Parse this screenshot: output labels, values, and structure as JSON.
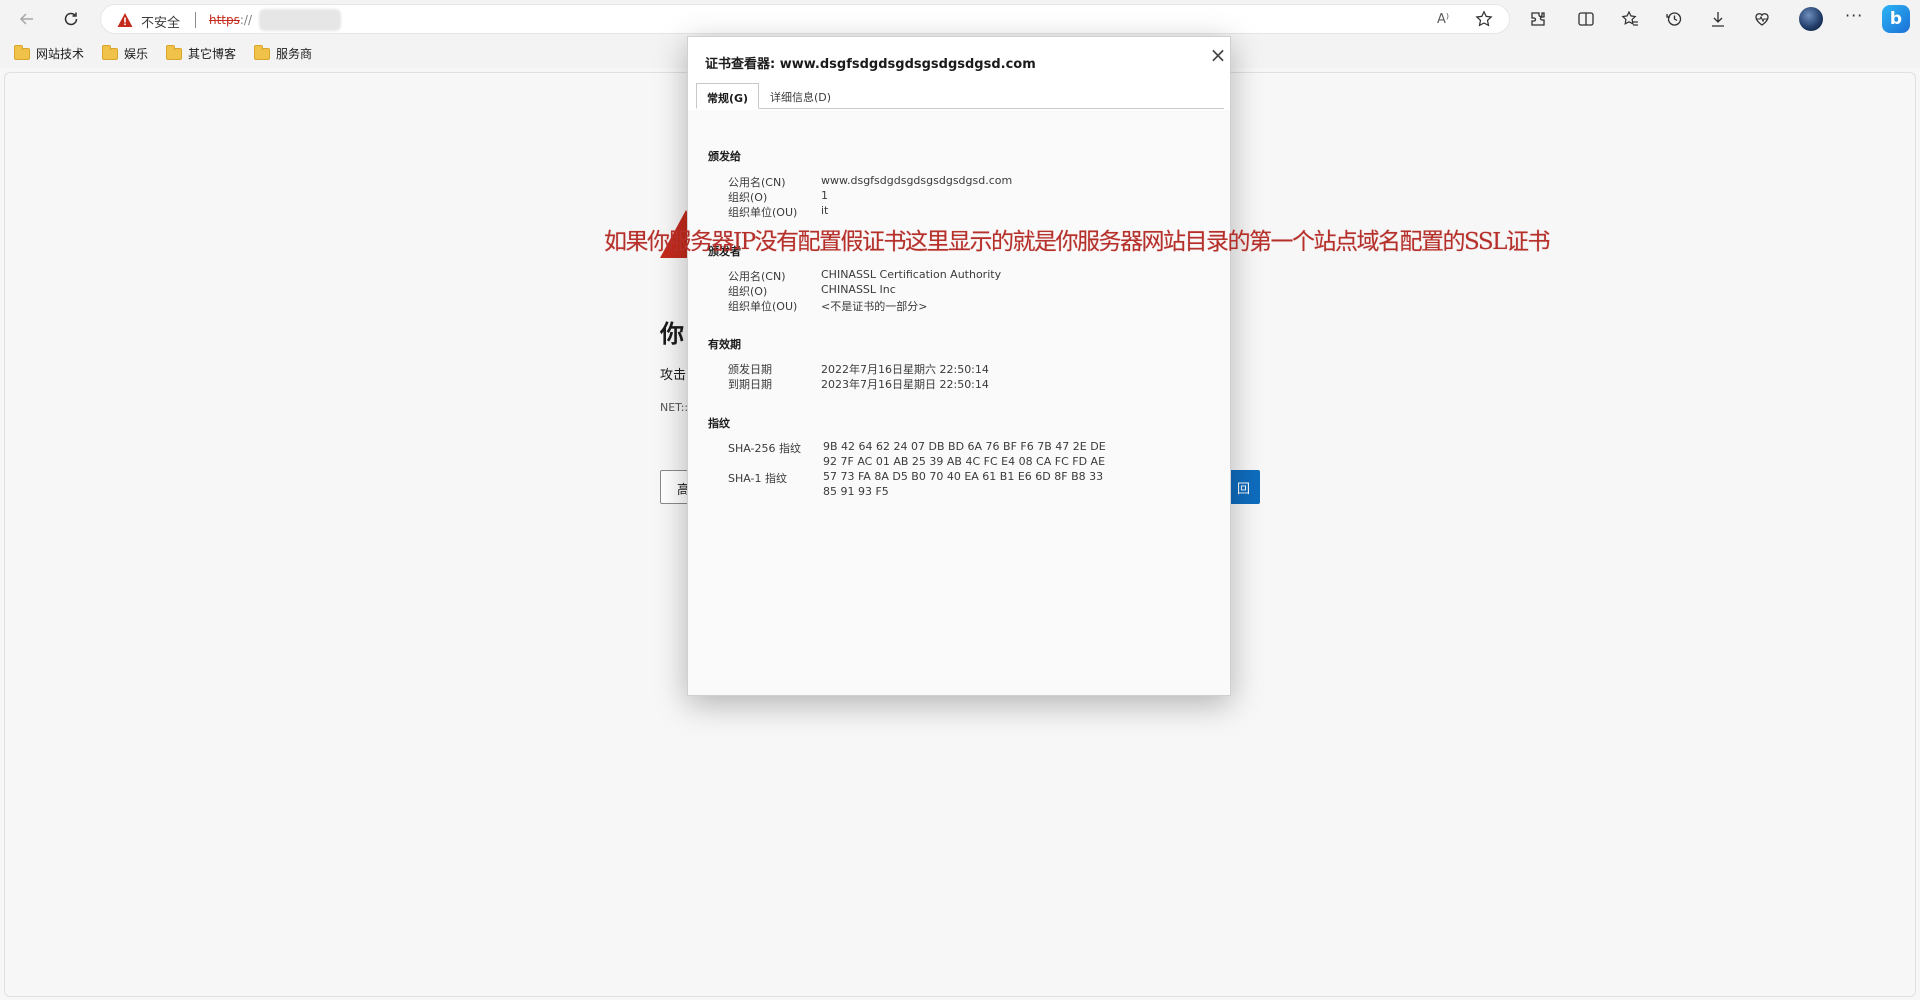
{
  "browser": {
    "security_label": "不安全",
    "url_scheme": "https",
    "url_rest": "://",
    "read_aloud_label": "A⁾"
  },
  "bookmarks": [
    {
      "label": "网站技术"
    },
    {
      "label": "娱乐"
    },
    {
      "label": "其它博客"
    },
    {
      "label": "服务商"
    }
  ],
  "error_page": {
    "heading": "你",
    "body": "攻击",
    "code": "NET::",
    "advanced_button": "高",
    "back_button": "回"
  },
  "dialog": {
    "title": "证书查看器: www.dsgfsdgdsgdsgsdgsdgsd.com",
    "tabs": [
      {
        "label": "常规(G)",
        "active": true
      },
      {
        "label": "详细信息(D)",
        "active": false
      }
    ],
    "issued_to": {
      "heading": "颁发给",
      "rows": [
        {
          "label": "公用名(CN)",
          "value": "www.dsgfsdgdsgdsgsdgsdgsd.com"
        },
        {
          "label": "组织(O)",
          "value": "1"
        },
        {
          "label": "组织单位(OU)",
          "value": "it"
        }
      ]
    },
    "issued_by": {
      "heading": "颁发者",
      "rows": [
        {
          "label": "公用名(CN)",
          "value": "CHINASSL Certification Authority"
        },
        {
          "label": "组织(O)",
          "value": "CHINASSL Inc"
        },
        {
          "label": "组织单位(OU)",
          "value": "<不是证书的一部分>"
        }
      ]
    },
    "validity": {
      "heading": "有效期",
      "rows": [
        {
          "label": "颁发日期",
          "value": "2022年7月16日星期六 22:50:14"
        },
        {
          "label": "到期日期",
          "value": "2023年7月16日星期日 22:50:14"
        }
      ]
    },
    "fingerprints": {
      "heading": "指纹",
      "sha256_label": "SHA-256 指纹",
      "sha256_line1": "9B 42 64 62 24 07 DB BD 6A 76 BF F6 7B 47 2E DE",
      "sha256_line2": "92 7F AC 01 AB 25 39 AB 4C FC E4 08 CA FC FD AE",
      "sha1_label": "SHA-1 指纹",
      "sha1_line1": "57 73 FA 8A D5 B0 70 40 EA 61 B1 E6 6D 8F B8 33",
      "sha1_line2": "85 91 93 F5"
    }
  },
  "annotation": "如果你服务器IP没有配置假证书这里显示的就是你服务器网站目录的第一个站点域名配置的SSL证书",
  "colors": {
    "insecure_red": "#c42b1c",
    "annotation_red": "#b5302a",
    "primary_blue": "#0f6cbd"
  }
}
